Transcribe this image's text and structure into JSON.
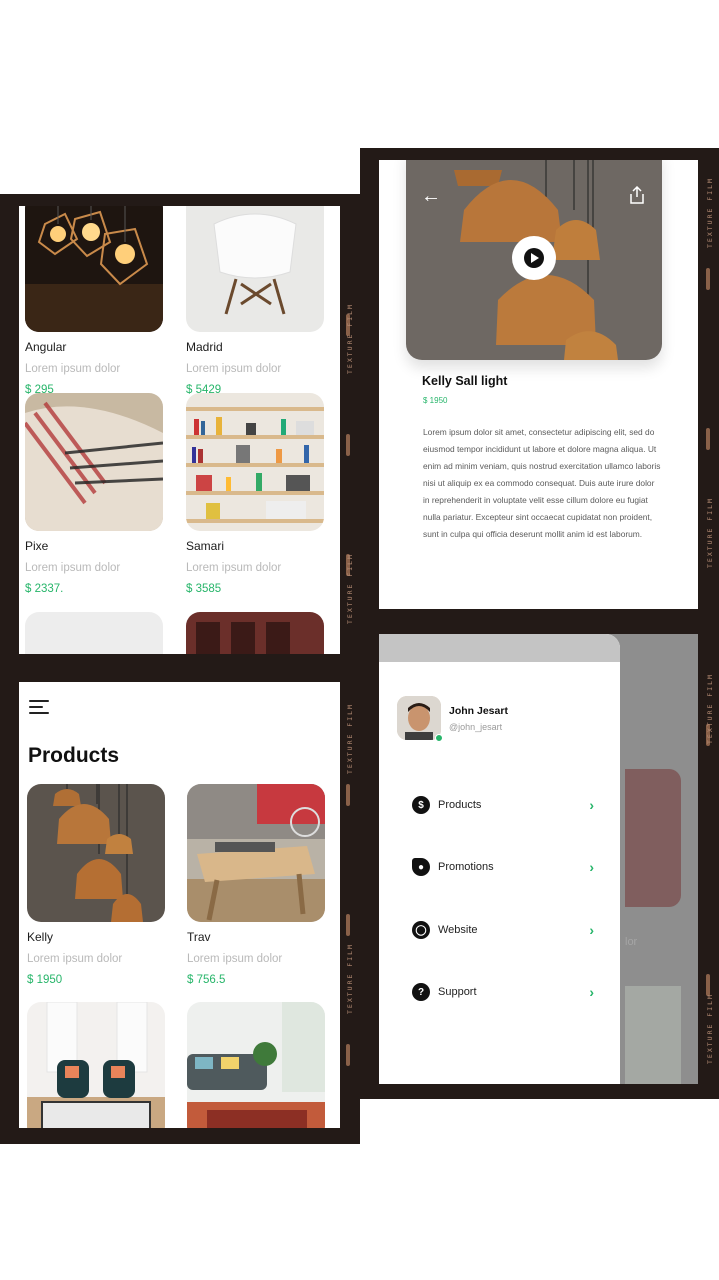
{
  "top_left": {
    "products": [
      {
        "name": "Angular",
        "desc": "Lorem ipsum dolor",
        "price": "$ 295",
        "image": "copper-cage-bulbs"
      },
      {
        "name": "Madrid",
        "desc": "Lorem ipsum dolor",
        "price": "$ 5429",
        "image": "white-chair"
      },
      {
        "name": "Pixe",
        "desc": "Lorem ipsum dolor",
        "price": "$ 2337.",
        "image": "woven-blanket"
      },
      {
        "name": "Samari",
        "desc": "Lorem ipsum dolor",
        "price": "$ 3585",
        "image": "bookshelf"
      }
    ]
  },
  "bottom_left": {
    "title": "Products",
    "menu_icon": "hamburger-icon",
    "products": [
      {
        "name": "Kelly",
        "desc": "Lorem ipsum dolor",
        "price": "$ 1950",
        "image": "pendant-lamps"
      },
      {
        "name": "Trav",
        "desc": "Lorem ipsum dolor",
        "price": "$ 756.5",
        "image": "coffee-table"
      },
      {
        "name": "",
        "desc": "",
        "price": "",
        "image": "living-room-chairs"
      },
      {
        "name": "",
        "desc": "",
        "price": "",
        "image": "living-room-sofa"
      }
    ]
  },
  "detail": {
    "back_icon": "arrow-left-icon",
    "share_icon": "share-icon",
    "play_icon": "play-icon",
    "title": "Kelly Sall light",
    "price": "$ 1950",
    "description": "Lorem ipsum dolor sit amet, consectetur adipiscing elit, sed do eiusmod tempor incididunt ut labore et dolore magna aliqua. Ut enim ad minim veniam, quis nostrud exercitation ullamco laboris nisi ut aliquip ex ea commodo consequat. Duis aute irure dolor in reprehenderit in voluptate velit esse cillum dolore eu fugiat nulla pariatur. Excepteur sint occaecat cupidatat non proident, sunt in culpa qui officia deserunt mollit anim id est laborum."
  },
  "drawer": {
    "user_name": "John Jesart",
    "user_handle": "@john_jesart",
    "online_color": "#27b56a",
    "items": [
      {
        "label": "Products",
        "icon": "dollar-icon"
      },
      {
        "label": "Promotions",
        "icon": "tag-icon"
      },
      {
        "label": "Website",
        "icon": "globe-icon"
      },
      {
        "label": "Support",
        "icon": "help-icon"
      }
    ],
    "behind_text": "lor"
  },
  "film_label": "TEXTURE FILM",
  "colors": {
    "accent": "#27b56a",
    "film": "#231a17",
    "text_muted": "#b9b9b9"
  }
}
